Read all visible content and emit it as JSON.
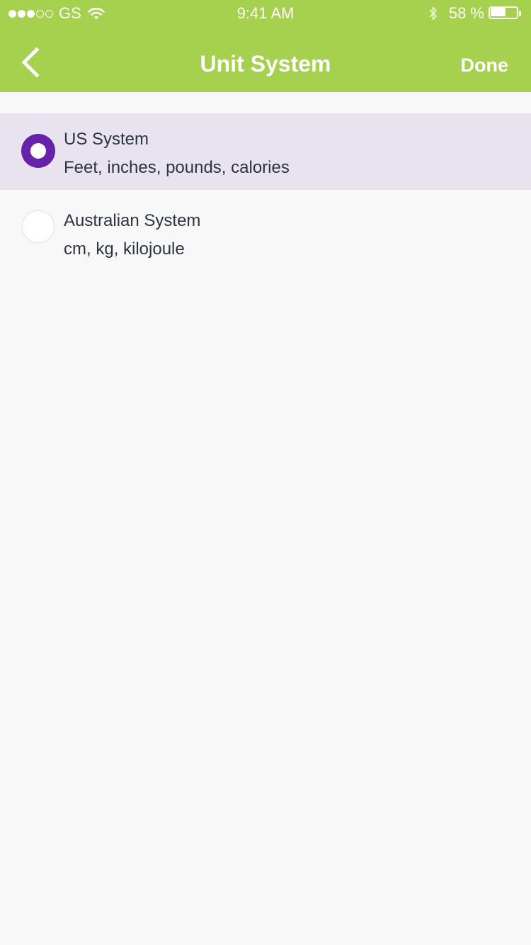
{
  "status_bar": {
    "carrier": "GS",
    "time": "9:41 AM",
    "battery_percent_text": "58 %",
    "battery_level": 0.58,
    "signal_bars_filled": 3,
    "signal_bars_total": 5,
    "icons": [
      "wifi-icon",
      "bluetooth-icon",
      "battery-icon"
    ]
  },
  "nav": {
    "title": "Unit System",
    "done_label": "Done",
    "back_icon": "chevron-left-icon"
  },
  "options": [
    {
      "title": "US System",
      "subtitle": "Feet, inches, pounds, calories",
      "selected": true
    },
    {
      "title": "Australian System",
      "subtitle": "cm, kg, kilojoule",
      "selected": false
    }
  ],
  "colors": {
    "header": "#a6d14e",
    "accent": "#6622aa",
    "selected_row": "#e8e3ef",
    "background": "#f8f8f8"
  }
}
